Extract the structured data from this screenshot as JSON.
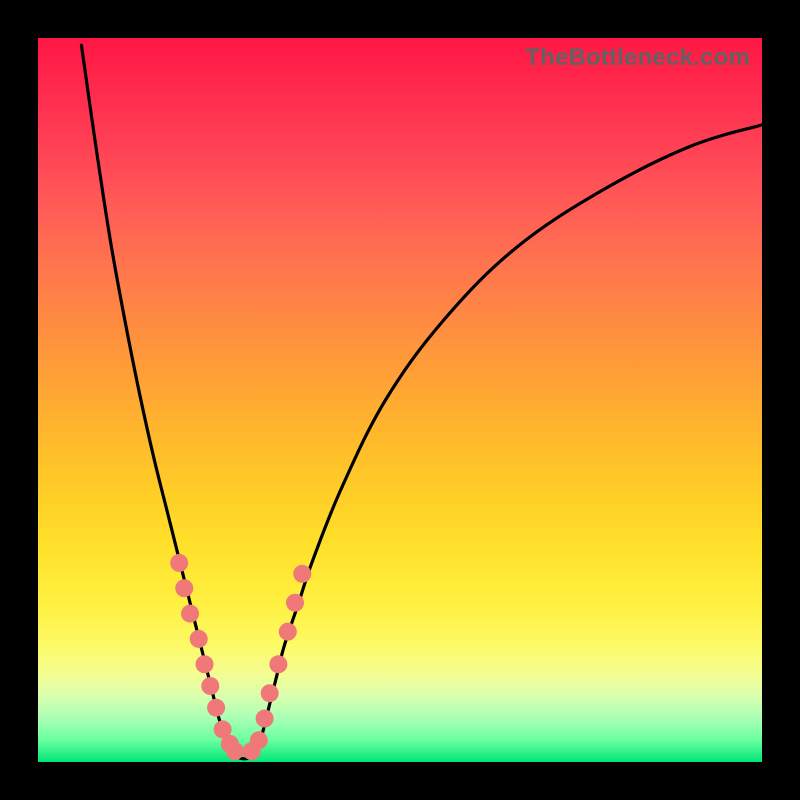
{
  "source_label": "TheBottleneck.com",
  "chart_data": {
    "type": "line",
    "title": "TheBottleneck.com",
    "xlabel": "",
    "ylabel": "",
    "xlim": [
      0,
      100
    ],
    "ylim": [
      0,
      100
    ],
    "series": [
      {
        "name": "left_curve",
        "values_x": [
          6,
          8,
          10,
          12,
          14,
          16,
          18,
          20,
          21,
          22,
          23,
          24,
          25,
          26,
          27
        ],
        "values_y": [
          99,
          85,
          72,
          61,
          51,
          42,
          34,
          26,
          22,
          18,
          14,
          10,
          6,
          3,
          1
        ]
      },
      {
        "name": "right_curve",
        "values_x": [
          30,
          31,
          32,
          33,
          34,
          36,
          38,
          42,
          48,
          56,
          66,
          78,
          90,
          100
        ],
        "values_y": [
          1,
          4,
          8,
          12,
          16,
          22,
          28,
          38,
          50,
          61,
          71,
          79,
          85,
          88
        ]
      },
      {
        "name": "floor",
        "values_x": [
          27,
          28,
          29,
          30
        ],
        "values_y": [
          1,
          0.5,
          0.5,
          1
        ]
      }
    ],
    "markers": {
      "color": "#f07878",
      "points_x": [
        19.5,
        20.2,
        21.0,
        22.2,
        23.0,
        23.8,
        24.6,
        25.5,
        26.5,
        27.2,
        29.5,
        30.5,
        31.3,
        32.0,
        33.2,
        34.5,
        35.5,
        36.5
      ],
      "points_y": [
        27.5,
        24.0,
        20.5,
        17.0,
        13.5,
        10.5,
        7.5,
        4.5,
        2.5,
        1.5,
        1.5,
        3.0,
        6.0,
        9.5,
        13.5,
        18.0,
        22.0,
        26.0
      ]
    },
    "grid": false,
    "legend": false
  }
}
